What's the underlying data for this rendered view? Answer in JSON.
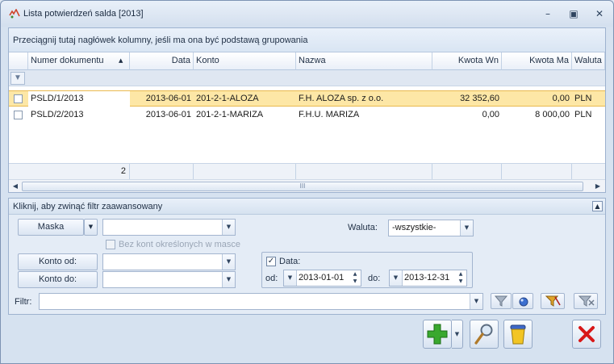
{
  "window": {
    "title": "Lista potwierdzeń salda [2013]"
  },
  "grid": {
    "group_hint": "Przeciągnij tutaj nagłówek kolumny, jeśli ma ona być podstawą grupowania",
    "columns": [
      "Numer dokumentu",
      "Data",
      "Konto",
      "Nazwa",
      "Kwota Wn",
      "Kwota Ma",
      "Waluta"
    ],
    "sort_column": "Numer dokumentu",
    "rows": [
      {
        "numer": "PSLD/1/2013",
        "data": "2013-06-01",
        "konto": "201-2-1-ALOZA",
        "nazwa": "F.H. ALOZA sp. z o.o.",
        "wn": "32 352,60",
        "ma": "0,00",
        "waluta": "PLN",
        "selected": true
      },
      {
        "numer": "PSLD/2/2013",
        "data": "2013-06-01",
        "konto": "201-2-1-MARIZA",
        "nazwa": "F.H.U. MARIZA",
        "wn": "0,00",
        "ma": "8 000,00",
        "waluta": "PLN",
        "selected": false
      }
    ],
    "footer_count": "2",
    "scroll_grip": "III"
  },
  "filter": {
    "header": "Kliknij, aby zwinąć filtr zaawansowany",
    "maska_label": "Maska",
    "maska_value": "",
    "bez_kont_label": "Bez kont określonych w masce",
    "konto_od_label": "Konto od:",
    "konto_od_value": "",
    "konto_do_label": "Konto do:",
    "konto_do_value": "",
    "waluta_label": "Waluta:",
    "waluta_value": "-wszystkie-",
    "data_label": "Data:",
    "od_label": "od:",
    "od_value": "2013-01-01",
    "do_label": "do:",
    "do_value": "2013-12-31",
    "filtr_label": "Filtr:",
    "filtr_value": ""
  },
  "colors": {
    "selection": "#fde7a6",
    "accent": "#9db2cf",
    "add_green": "#39a82e",
    "delete_red": "#d81818"
  }
}
